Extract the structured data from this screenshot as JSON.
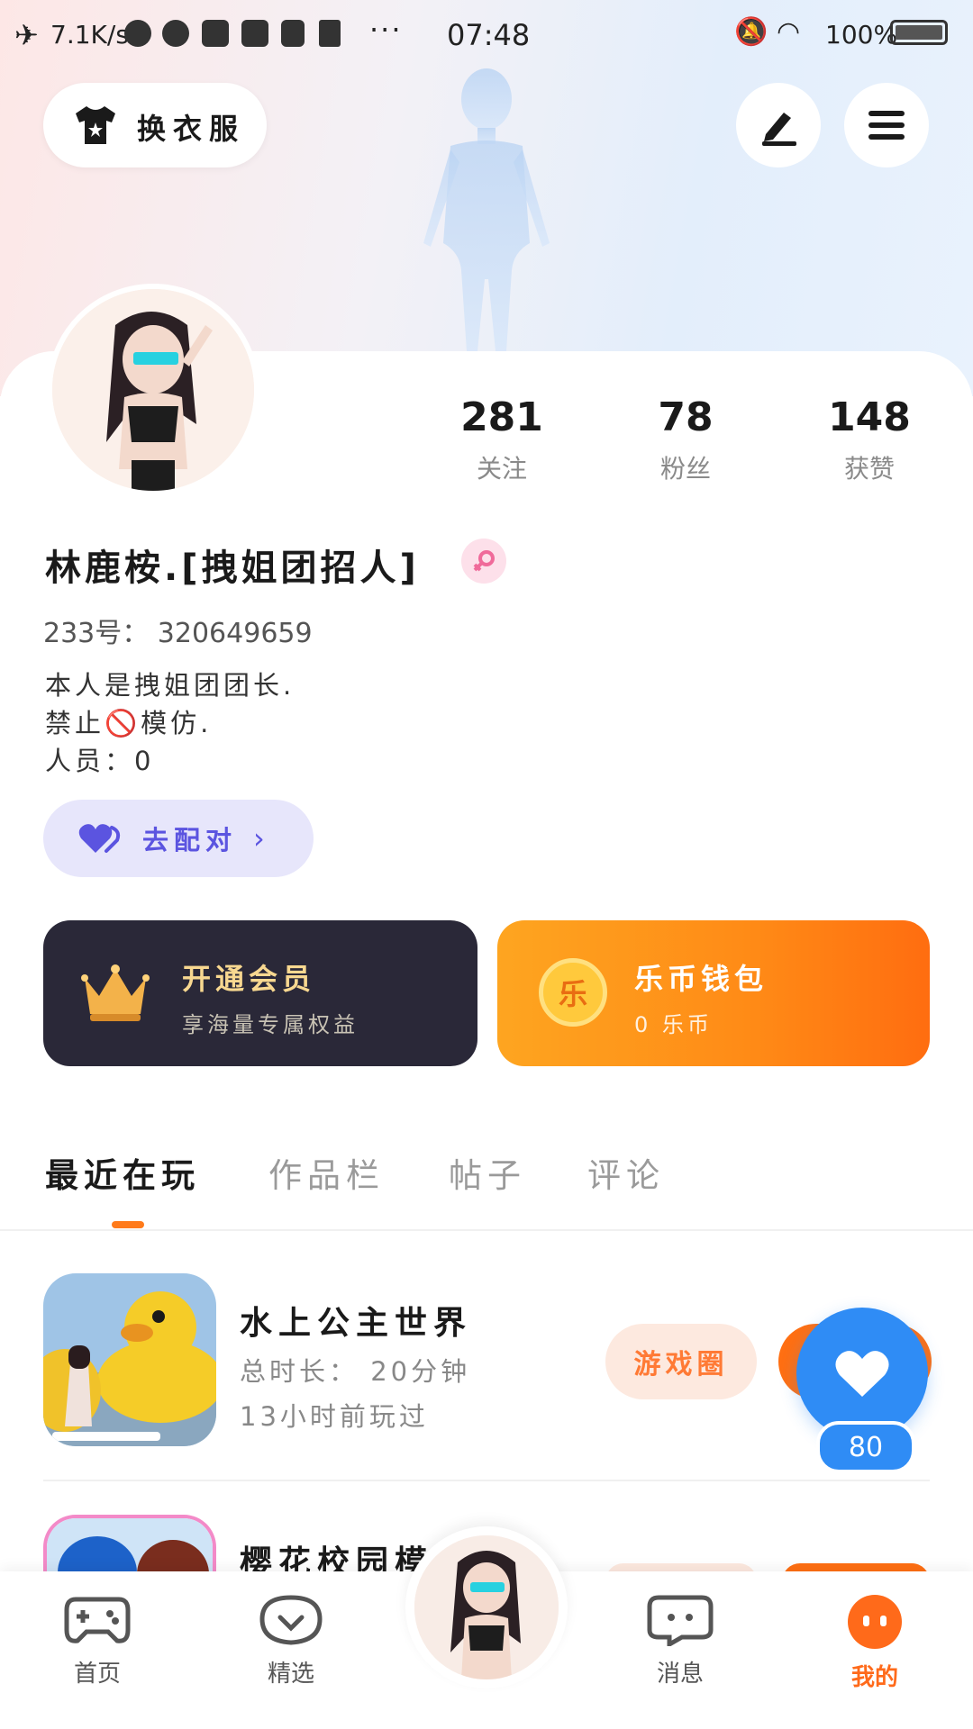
{
  "status_bar": {
    "speed": "7.1K/s",
    "time": "07:48",
    "battery": "100%"
  },
  "header": {
    "change_clothes_label": "换衣服",
    "edit_icon": "pen-icon",
    "menu_icon": "hamburger-icon"
  },
  "profile": {
    "stats": [
      {
        "value": "281",
        "label": "关注"
      },
      {
        "value": "78",
        "label": "粉丝"
      },
      {
        "value": "148",
        "label": "获赞"
      }
    ],
    "name": "林鹿桉.[拽姐团招人]",
    "gender": "female",
    "uid": "233号： 320649659",
    "bio": [
      "本人是拽姐团团长.",
      "禁止🚫模仿.",
      "人员：0"
    ],
    "pair_label": "去配对"
  },
  "cards": {
    "vip_title": "开通会员",
    "vip_sub": "享海量专属权益",
    "coin_title": "乐币钱包",
    "coin_sub": "0 乐币",
    "coin_badge": "乐"
  },
  "tabs": [
    "最近在玩",
    "作品栏",
    "帖子",
    "评论"
  ],
  "games": [
    {
      "title": "水上公主世界",
      "duration": "总时长： 20分钟",
      "last_played": "13小时前玩过",
      "circle_label": "游戏圈"
    },
    {
      "title": "樱花校园模"
    }
  ],
  "like": {
    "count": "80"
  },
  "bottom_nav": [
    {
      "label": "首页"
    },
    {
      "label": "精选"
    },
    {
      "label": "消息"
    },
    {
      "label": "我的"
    }
  ],
  "colors": {
    "accent_orange": "#ff7a1a",
    "like_blue": "#2f8cf5",
    "vip_dark": "#2a2838"
  }
}
